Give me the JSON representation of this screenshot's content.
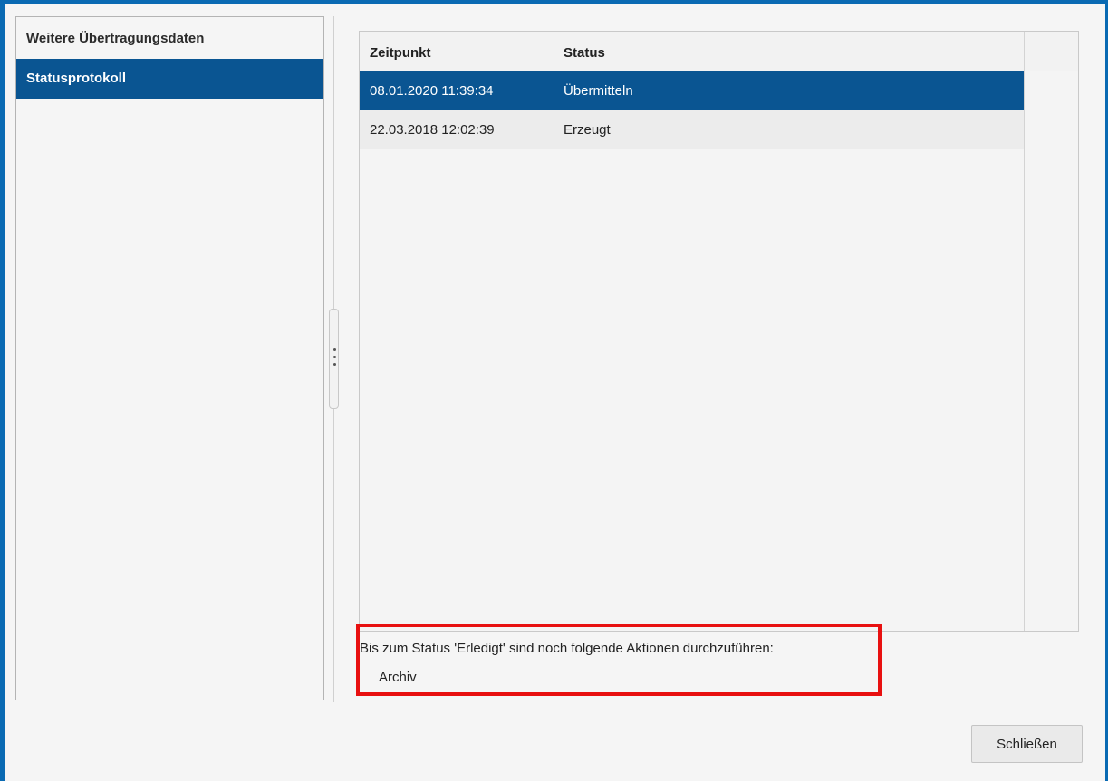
{
  "nav": {
    "items": [
      {
        "label": "Weitere Übertragungsdaten",
        "selected": false
      },
      {
        "label": "Statusprotokoll",
        "selected": true
      }
    ]
  },
  "table": {
    "columns": [
      "Zeitpunkt",
      "Status"
    ],
    "rows": [
      {
        "zeitpunkt": "08.01.2020 11:39:34",
        "status": "Übermitteln",
        "selected": true
      },
      {
        "zeitpunkt": "22.03.2018 12:02:39",
        "status": "Erzeugt",
        "selected": false
      }
    ]
  },
  "info": {
    "message": "Bis zum Status 'Erledigt' sind noch folgende Aktionen durchzuführen:",
    "actions": [
      "Archiv"
    ]
  },
  "buttons": {
    "close_label": "Schließen"
  },
  "colors": {
    "accent": "#0a5592",
    "window_border": "#0a6ab3",
    "highlight": "#e81010"
  }
}
